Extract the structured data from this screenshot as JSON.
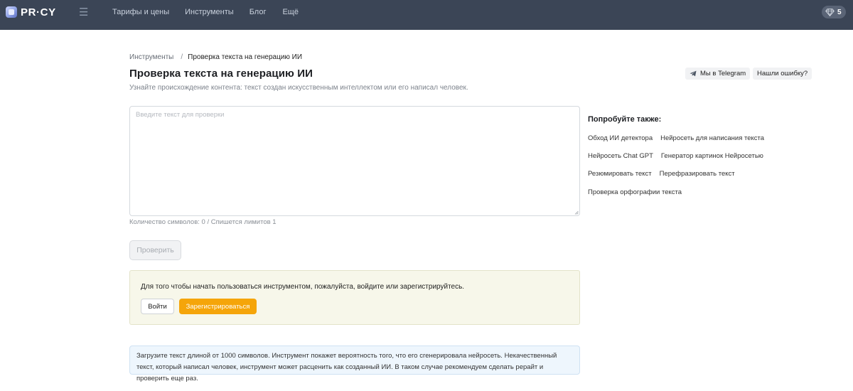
{
  "header": {
    "logo_text": "PR·CY",
    "menu_icon": "hamburger-icon",
    "nav": [
      "Тарифы и цены",
      "Инструменты",
      "Блог",
      "Ещё"
    ],
    "gems_icon": "diamond-icon",
    "gems_count": "5"
  },
  "breadcrumb": {
    "parent": "Инструменты",
    "separator": "/",
    "current": "Проверка текста на генерацию ИИ"
  },
  "page": {
    "title": "Проверка текста на генерацию ИИ",
    "subtitle": "Узнайте происхождение контента: текст создан искусственным интеллектом или его написал человек."
  },
  "actions": {
    "telegram_label": "Мы в Telegram",
    "telegram_icon": "telegram-icon",
    "report_label": "Нашли ошибку?"
  },
  "form": {
    "textarea_placeholder": "Введите текст для проверки",
    "textarea_value": "",
    "char_count": "Количество символов: 0 / Спишется лимитов 1",
    "check_button": "Проверить"
  },
  "notice": {
    "text": "Для того чтобы начать пользоваться инструментом, пожалуйста, войдите или зарегистрируйтесь.",
    "login_button": "Войти",
    "register_button": "Зарегистрироваться",
    "register_color": "#f5a50a"
  },
  "info": {
    "text": "Загрузите текст длиной от 1000 символов. Инструмент покажет вероятность того, что его сгенерировала нейросеть. Некачественный текст, который написал человек, инструмент может расценить как созданный ИИ. В таком случае рекомендуем сделать рерайт и проверить еще раз."
  },
  "try_also": {
    "title": "Попробуйте также:",
    "rows": [
      [
        "Обход ИИ детектора",
        "Нейросеть для написания текста"
      ],
      [
        "Нейросеть Chat GPT",
        "Генератор картинок Нейросетью"
      ],
      [
        "Резюмировать текст",
        "Перефразировать текст"
      ],
      [
        "Проверка орфографии текста"
      ]
    ]
  },
  "colors": {
    "topbar": "#3b4556",
    "accent": "#f5a50a"
  }
}
